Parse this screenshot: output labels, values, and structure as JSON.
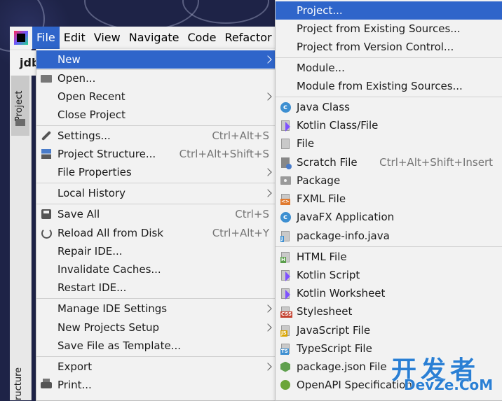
{
  "menubar": {
    "items": [
      {
        "label": "File",
        "active": true
      },
      {
        "label": "Edit"
      },
      {
        "label": "View"
      },
      {
        "label": "Navigate"
      },
      {
        "label": "Code"
      },
      {
        "label": "Refactor"
      }
    ]
  },
  "editor_tab": {
    "label": "jdb"
  },
  "tool_windows": {
    "project": "Project",
    "structure": "ructure"
  },
  "file_menu": {
    "items": [
      {
        "label": "New",
        "has_submenu": true,
        "highlighted": true
      },
      {
        "label": "Open...",
        "icon": "folder-open-icon"
      },
      {
        "label": "Open Recent",
        "has_submenu": true
      },
      {
        "label": "Close Project"
      },
      {
        "label": "Settings...",
        "shortcut": "Ctrl+Alt+S",
        "icon": "wrench-icon"
      },
      {
        "label": "Project Structure...",
        "shortcut": "Ctrl+Alt+Shift+S",
        "icon": "project-structure-icon"
      },
      {
        "label": "File Properties",
        "has_submenu": true
      },
      {
        "label": "Local History",
        "has_submenu": true
      },
      {
        "label": "Save All",
        "shortcut": "Ctrl+S",
        "icon": "save-icon"
      },
      {
        "label": "Reload All from Disk",
        "shortcut": "Ctrl+Alt+Y",
        "icon": "reload-icon"
      },
      {
        "label": "Repair IDE..."
      },
      {
        "label": "Invalidate Caches..."
      },
      {
        "label": "Restart IDE..."
      },
      {
        "label": "Manage IDE Settings",
        "has_submenu": true
      },
      {
        "label": "New Projects Setup",
        "has_submenu": true
      },
      {
        "label": "Save File as Template..."
      },
      {
        "label": "Export",
        "has_submenu": true
      },
      {
        "label": "Print...",
        "icon": "print-icon"
      }
    ]
  },
  "new_menu": {
    "items": [
      {
        "label": "Project...",
        "highlighted": true
      },
      {
        "label": "Project from Existing Sources..."
      },
      {
        "label": "Project from Version Control..."
      },
      {
        "label": "Module..."
      },
      {
        "label": "Module from Existing Sources..."
      },
      {
        "label": "Java Class",
        "icon": "java-class-icon"
      },
      {
        "label": "Kotlin Class/File",
        "icon": "kotlin-file-icon"
      },
      {
        "label": "File",
        "icon": "file-icon"
      },
      {
        "label": "Scratch File",
        "shortcut": "Ctrl+Alt+Shift+Insert",
        "icon": "scratch-file-icon"
      },
      {
        "label": "Package",
        "icon": "package-icon"
      },
      {
        "label": "FXML File",
        "icon": "fxml-file-icon"
      },
      {
        "label": "JavaFX Application",
        "icon": "javafx-icon"
      },
      {
        "label": "package-info.java",
        "icon": "java-file-icon"
      },
      {
        "label": "HTML File",
        "icon": "html-file-icon"
      },
      {
        "label": "Kotlin Script",
        "icon": "kotlin-script-icon"
      },
      {
        "label": "Kotlin Worksheet",
        "icon": "kotlin-worksheet-icon"
      },
      {
        "label": "Stylesheet",
        "icon": "css-file-icon"
      },
      {
        "label": "JavaScript File",
        "icon": "js-file-icon"
      },
      {
        "label": "TypeScript File",
        "icon": "ts-file-icon"
      },
      {
        "label": "package.json File",
        "icon": "nodejs-icon"
      },
      {
        "label": "OpenAPI Specification",
        "icon": "openapi-icon"
      }
    ]
  },
  "watermark": {
    "big": "开发者",
    "small": "DevZe.CoM"
  },
  "colors": {
    "highlight": "#2f65ca",
    "menu_bg": "#f2f2f2",
    "java": "#3d8fd1",
    "kotlin": "#7f52ff"
  }
}
